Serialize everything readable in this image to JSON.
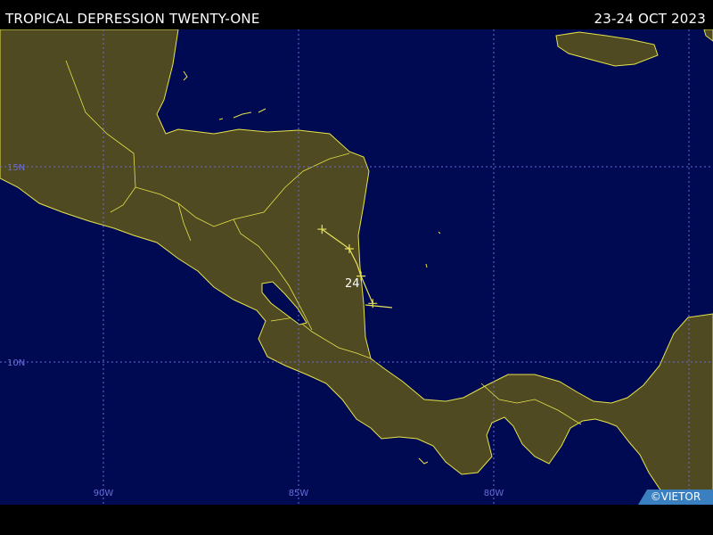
{
  "header": {
    "title": "TROPICAL DEPRESSION TWENTY-ONE",
    "date_range": "23-24 OCT 2023"
  },
  "map": {
    "colors": {
      "ocean": "#000a52",
      "land": "#4f4a22",
      "coast": "#e6e24a",
      "grid": "#6b6bd8",
      "track": "#e8e25a",
      "marker": "#e8e25a",
      "label": "#ffffff"
    },
    "latitude_labels": [
      "15N",
      "10N"
    ],
    "longitude_labels": [
      "90W",
      "85W",
      "80W"
    ],
    "storm_track": {
      "points": [
        {
          "lon": -84.4,
          "lat": 13.4
        },
        {
          "lon": -83.7,
          "lat": 12.9
        },
        {
          "lon": -83.5,
          "lat": 12.5
        },
        {
          "lon": -83.4,
          "lat": 12.2
        },
        {
          "lon": -83.1,
          "lat": 11.5
        }
      ],
      "day_label": "24"
    }
  },
  "footer": {
    "credit": "©VIETOR"
  }
}
